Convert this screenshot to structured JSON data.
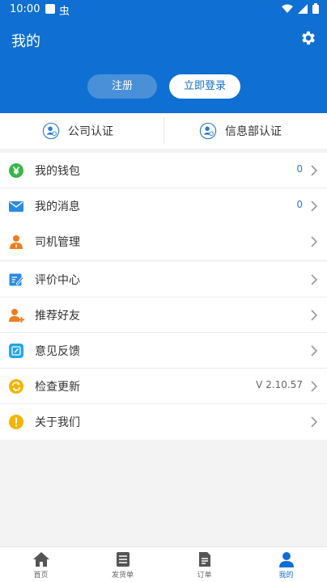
{
  "status_bar": {
    "time": "10:00",
    "app_glyph": "虫"
  },
  "header": {
    "title": "我的",
    "register_label": "注册",
    "login_label": "立即登录"
  },
  "cert": {
    "company": "公司认证",
    "info_dept": "信息部认证"
  },
  "menu": {
    "wallet": {
      "label": "我的钱包",
      "value": "0"
    },
    "messages": {
      "label": "我的消息",
      "value": "0"
    },
    "drivers": {
      "label": "司机管理"
    },
    "reviews": {
      "label": "评价中心"
    },
    "recommend": {
      "label": "推荐好友"
    },
    "feedback": {
      "label": "意见反馈"
    },
    "update": {
      "label": "检查更新",
      "value": "V 2.10.57"
    },
    "about": {
      "label": "关于我们"
    }
  },
  "bottom_nav": {
    "home": "首页",
    "shipping": "发货单",
    "orders": "订单",
    "mine": "我的"
  },
  "colors": {
    "brand": "#0f6fd2",
    "wallet_icon": "#3bb54a",
    "message_icon": "#2a8be0",
    "driver_icon": "#f07d1e",
    "about_icon": "#f5b400"
  }
}
